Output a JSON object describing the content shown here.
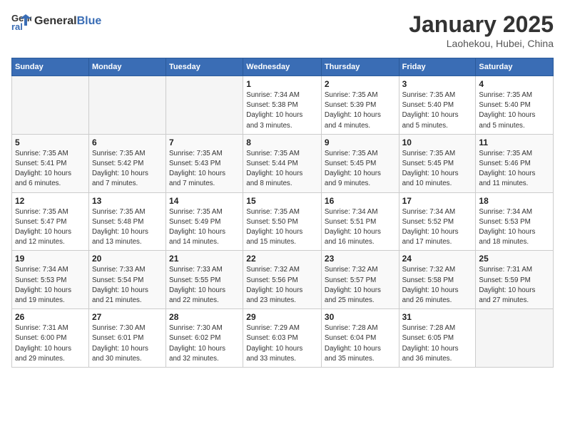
{
  "logo": {
    "text_general": "General",
    "text_blue": "Blue"
  },
  "header": {
    "month": "January 2025",
    "location": "Laohekou, Hubei, China"
  },
  "weekdays": [
    "Sunday",
    "Monday",
    "Tuesday",
    "Wednesday",
    "Thursday",
    "Friday",
    "Saturday"
  ],
  "weeks": [
    [
      {
        "day": "",
        "info": ""
      },
      {
        "day": "",
        "info": ""
      },
      {
        "day": "",
        "info": ""
      },
      {
        "day": "1",
        "info": "Sunrise: 7:34 AM\nSunset: 5:38 PM\nDaylight: 10 hours\nand 3 minutes."
      },
      {
        "day": "2",
        "info": "Sunrise: 7:35 AM\nSunset: 5:39 PM\nDaylight: 10 hours\nand 4 minutes."
      },
      {
        "day": "3",
        "info": "Sunrise: 7:35 AM\nSunset: 5:40 PM\nDaylight: 10 hours\nand 5 minutes."
      },
      {
        "day": "4",
        "info": "Sunrise: 7:35 AM\nSunset: 5:40 PM\nDaylight: 10 hours\nand 5 minutes."
      }
    ],
    [
      {
        "day": "5",
        "info": "Sunrise: 7:35 AM\nSunset: 5:41 PM\nDaylight: 10 hours\nand 6 minutes."
      },
      {
        "day": "6",
        "info": "Sunrise: 7:35 AM\nSunset: 5:42 PM\nDaylight: 10 hours\nand 7 minutes."
      },
      {
        "day": "7",
        "info": "Sunrise: 7:35 AM\nSunset: 5:43 PM\nDaylight: 10 hours\nand 7 minutes."
      },
      {
        "day": "8",
        "info": "Sunrise: 7:35 AM\nSunset: 5:44 PM\nDaylight: 10 hours\nand 8 minutes."
      },
      {
        "day": "9",
        "info": "Sunrise: 7:35 AM\nSunset: 5:45 PM\nDaylight: 10 hours\nand 9 minutes."
      },
      {
        "day": "10",
        "info": "Sunrise: 7:35 AM\nSunset: 5:45 PM\nDaylight: 10 hours\nand 10 minutes."
      },
      {
        "day": "11",
        "info": "Sunrise: 7:35 AM\nSunset: 5:46 PM\nDaylight: 10 hours\nand 11 minutes."
      }
    ],
    [
      {
        "day": "12",
        "info": "Sunrise: 7:35 AM\nSunset: 5:47 PM\nDaylight: 10 hours\nand 12 minutes."
      },
      {
        "day": "13",
        "info": "Sunrise: 7:35 AM\nSunset: 5:48 PM\nDaylight: 10 hours\nand 13 minutes."
      },
      {
        "day": "14",
        "info": "Sunrise: 7:35 AM\nSunset: 5:49 PM\nDaylight: 10 hours\nand 14 minutes."
      },
      {
        "day": "15",
        "info": "Sunrise: 7:35 AM\nSunset: 5:50 PM\nDaylight: 10 hours\nand 15 minutes."
      },
      {
        "day": "16",
        "info": "Sunrise: 7:34 AM\nSunset: 5:51 PM\nDaylight: 10 hours\nand 16 minutes."
      },
      {
        "day": "17",
        "info": "Sunrise: 7:34 AM\nSunset: 5:52 PM\nDaylight: 10 hours\nand 17 minutes."
      },
      {
        "day": "18",
        "info": "Sunrise: 7:34 AM\nSunset: 5:53 PM\nDaylight: 10 hours\nand 18 minutes."
      }
    ],
    [
      {
        "day": "19",
        "info": "Sunrise: 7:34 AM\nSunset: 5:53 PM\nDaylight: 10 hours\nand 19 minutes."
      },
      {
        "day": "20",
        "info": "Sunrise: 7:33 AM\nSunset: 5:54 PM\nDaylight: 10 hours\nand 21 minutes."
      },
      {
        "day": "21",
        "info": "Sunrise: 7:33 AM\nSunset: 5:55 PM\nDaylight: 10 hours\nand 22 minutes."
      },
      {
        "day": "22",
        "info": "Sunrise: 7:32 AM\nSunset: 5:56 PM\nDaylight: 10 hours\nand 23 minutes."
      },
      {
        "day": "23",
        "info": "Sunrise: 7:32 AM\nSunset: 5:57 PM\nDaylight: 10 hours\nand 25 minutes."
      },
      {
        "day": "24",
        "info": "Sunrise: 7:32 AM\nSunset: 5:58 PM\nDaylight: 10 hours\nand 26 minutes."
      },
      {
        "day": "25",
        "info": "Sunrise: 7:31 AM\nSunset: 5:59 PM\nDaylight: 10 hours\nand 27 minutes."
      }
    ],
    [
      {
        "day": "26",
        "info": "Sunrise: 7:31 AM\nSunset: 6:00 PM\nDaylight: 10 hours\nand 29 minutes."
      },
      {
        "day": "27",
        "info": "Sunrise: 7:30 AM\nSunset: 6:01 PM\nDaylight: 10 hours\nand 30 minutes."
      },
      {
        "day": "28",
        "info": "Sunrise: 7:30 AM\nSunset: 6:02 PM\nDaylight: 10 hours\nand 32 minutes."
      },
      {
        "day": "29",
        "info": "Sunrise: 7:29 AM\nSunset: 6:03 PM\nDaylight: 10 hours\nand 33 minutes."
      },
      {
        "day": "30",
        "info": "Sunrise: 7:28 AM\nSunset: 6:04 PM\nDaylight: 10 hours\nand 35 minutes."
      },
      {
        "day": "31",
        "info": "Sunrise: 7:28 AM\nSunset: 6:05 PM\nDaylight: 10 hours\nand 36 minutes."
      },
      {
        "day": "",
        "info": ""
      }
    ]
  ]
}
